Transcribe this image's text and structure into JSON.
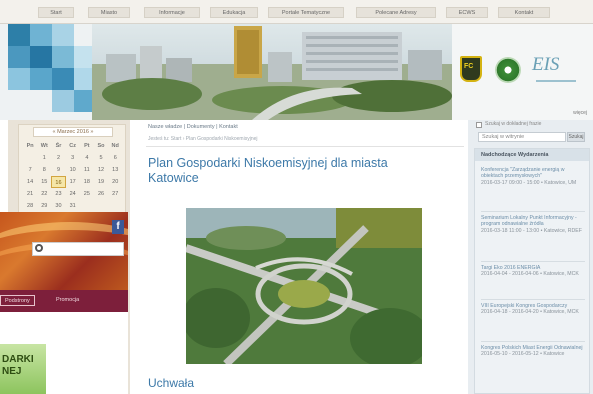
{
  "nav": {
    "items": [
      "Start",
      "Miasto",
      "Informacje",
      "Edukacja",
      "Portale Tematyczne",
      "Polecane Adresy",
      "ECWS",
      "Kontakt"
    ]
  },
  "banner": {
    "logos": [
      "coat-of-arms",
      "green-emblem",
      "eis-logo"
    ],
    "fc_letters": "FC",
    "eis_text": "EIS",
    "link": "więcej"
  },
  "calendar": {
    "title": "« Marzec 2016 »",
    "days_of_week": [
      "Pn",
      "Wt",
      "Śr",
      "Cz",
      "Pt",
      "So",
      "Nd"
    ],
    "weeks": [
      [
        "",
        "1",
        "2",
        "3",
        "4",
        "5",
        "6"
      ],
      [
        "7",
        "8",
        "9",
        "10",
        "11",
        "12",
        "13"
      ],
      [
        "14",
        "15",
        "16",
        "17",
        "18",
        "19",
        "20"
      ],
      [
        "21",
        "22",
        "23",
        "24",
        "25",
        "26",
        "27"
      ],
      [
        "28",
        "29",
        "30",
        "31",
        "",
        "",
        ""
      ]
    ],
    "highlighted_day": "16"
  },
  "overlay": {
    "facebook_letter": "f",
    "tabs": [
      "Podstrony",
      "Promocja"
    ],
    "active_tab": 0,
    "eco_logo_lines": [
      "DARKI",
      "NEJ"
    ]
  },
  "main": {
    "breadcrumb_nav": [
      "Nasze władze",
      "Dokumenty",
      "Kontakt"
    ],
    "breadcrumb_path": "Jesteś tu: Start › Plan Gospodarki Niskoemisyjnej",
    "title": "Plan Gospodarki Niskoemisyjnej dla miasta Katowice",
    "section_title": "Uchwała"
  },
  "sidebar": {
    "checkbox_label": "Szukaj w dokładnej frazie",
    "search_placeholder": "Szukaj w witrynie",
    "search_button": "Szukaj",
    "events_title": "Nadchodzące Wydarzenia",
    "events": [
      {
        "title": "Konferencja \"Zarządzanie energią w obiektach przemysłowych\"",
        "meta": "2016-03-17 09:00 - 15:00 • Katowice, UM"
      },
      {
        "title": "Seminarium Lokalny Punkt Informacyjny - program odnawialne źródła",
        "meta": "2016-03-18 11:00 - 13:00 • Katowice, RDEF"
      },
      {
        "title": "Targi Eko 2016 ENERGIA",
        "meta": "2016-04-04 - 2016-04-06 • Katowice, MCK"
      },
      {
        "title": "VIII Europejski Kongres Gospodarczy",
        "meta": "2016-04-18 - 2016-04-20 • Katowice, MCK"
      },
      {
        "title": "Kongres Polskich Miast Energii Odnawialnej",
        "meta": "2016-05-10 - 2016-05-12 • Katowice"
      }
    ]
  }
}
